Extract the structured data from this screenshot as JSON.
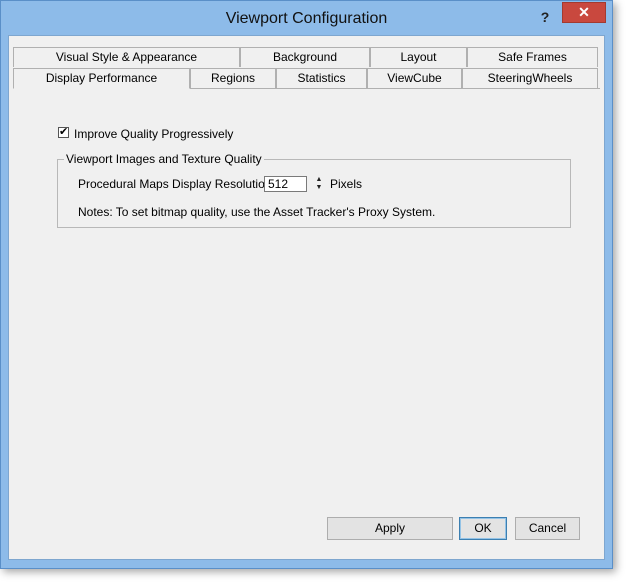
{
  "window": {
    "title": "Viewport Configuration",
    "help": "?",
    "close": "✕"
  },
  "tabs": {
    "row_back": [
      "Visual Style & Appearance",
      "Background",
      "Layout",
      "Safe Frames"
    ],
    "row_front": [
      "Display Performance",
      "Regions",
      "Statistics",
      "ViewCube",
      "SteeringWheels"
    ],
    "active": "Display Performance"
  },
  "options": {
    "improve_quality": {
      "label": "Improve Quality Progressively",
      "checked": true,
      "mark": "✔"
    }
  },
  "group": {
    "title": "Viewport Images and Texture Quality",
    "resolution_label": "Procedural Maps Display Resolution:",
    "resolution_value": "512",
    "units": "Pixels",
    "notes": "Notes: To set bitmap quality, use the Asset Tracker's Proxy System."
  },
  "buttons": {
    "apply": "Apply",
    "ok": "OK",
    "cancel": "Cancel"
  }
}
